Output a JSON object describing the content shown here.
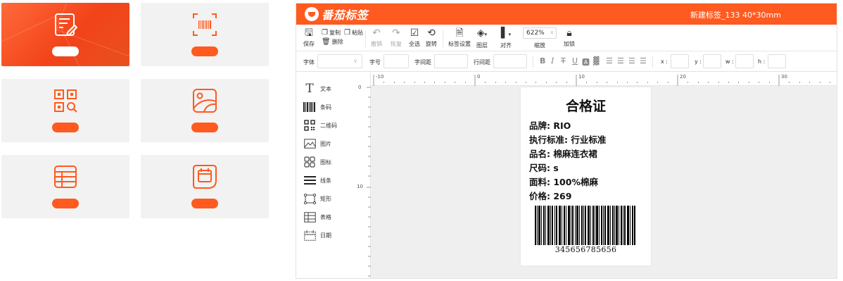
{
  "colors": {
    "brand": "#ff5a1f",
    "tile_bg": "#f2f2f2",
    "canvas_bg": "#efefef"
  },
  "tiles": [
    {
      "icon": "edit-document-icon",
      "active": true
    },
    {
      "icon": "barcode-scan-icon",
      "active": false
    },
    {
      "icon": "qr-code-search-icon",
      "active": false
    },
    {
      "icon": "image-icon",
      "active": false
    },
    {
      "icon": "table-icon",
      "active": false
    },
    {
      "icon": "calendar-icon",
      "active": false
    }
  ],
  "app": {
    "name": "番茄标签",
    "doc_title": "新建标签_133 40*30mm"
  },
  "toolbar": {
    "save": "保存",
    "copy": "复制",
    "paste": "粘贴",
    "delete": "删除",
    "undo": "撤销",
    "redo": "恢复",
    "select_all": "全选",
    "rotate": "旋转",
    "label_settings": "标签设置",
    "layers": "图层",
    "align": "对齐",
    "zoom_value": "622%",
    "zoom": "缩放",
    "lock": "加锁"
  },
  "props": {
    "font": "字体",
    "font_size": "字号",
    "letter_spacing": "字间距",
    "line_spacing": "行间距",
    "x": "x :",
    "y": "y :",
    "w": "w :",
    "h": "h :"
  },
  "sidebar": {
    "tools": [
      {
        "label": "文本",
        "icon": "text-icon"
      },
      {
        "label": "条码",
        "icon": "barcode-icon"
      },
      {
        "label": "二维码",
        "icon": "qr-code-icon"
      },
      {
        "label": "图片",
        "icon": "picture-icon"
      },
      {
        "label": "图标",
        "icon": "grid-icon"
      },
      {
        "label": "线条",
        "icon": "lines-icon"
      },
      {
        "label": "矩形",
        "icon": "rectangle-icon"
      },
      {
        "label": "表格",
        "icon": "table-icon"
      },
      {
        "label": "日期",
        "icon": "date-icon"
      }
    ]
  },
  "ruler": {
    "h_labels": [
      "-10",
      "0",
      "10",
      "20",
      "30"
    ],
    "v_labels": [
      "0",
      "10"
    ]
  },
  "label": {
    "title": "合格证",
    "lines": [
      "品牌: RIO",
      "执行标准: 行业标准",
      "品名: 棉麻连衣裙",
      "尺码: s",
      "面料: 100%棉麻",
      "价格: 269"
    ],
    "barcode_number": "345656785656"
  }
}
